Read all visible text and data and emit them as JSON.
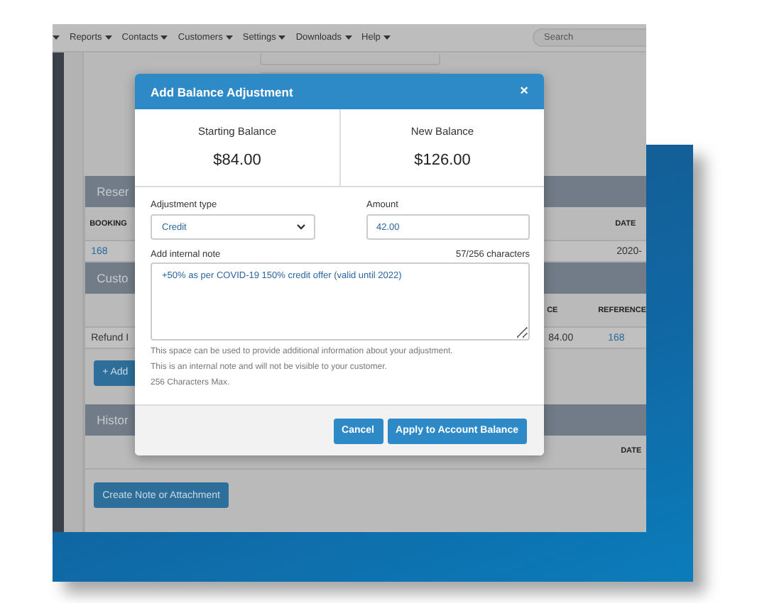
{
  "app": {
    "nav": {
      "leading_caret": true,
      "items": [
        "Reports",
        "Contacts",
        "Customers",
        "Settings",
        "Downloads",
        "Help"
      ],
      "search": {
        "placeholder": "Search"
      }
    },
    "reservations": {
      "title": "Reser",
      "columns": [
        "BOOKING",
        "DATE"
      ],
      "row": [
        "168",
        "2020-"
      ]
    },
    "customer_credit": {
      "title": "Custo",
      "columns": [
        "CE",
        "REFERENCE"
      ],
      "row": [
        "Refund I",
        "84.00",
        "168"
      ],
      "button": "+ Add"
    },
    "history": {
      "title": "Histor",
      "columns": [
        "DATE"
      ],
      "button": "Create Note or Attachment"
    }
  },
  "modal": {
    "title": "Add Balance Adjustment",
    "close": "×",
    "balances": [
      {
        "label": "Starting Balance",
        "value": "$84.00"
      },
      {
        "label": "New Balance",
        "value": "$126.00"
      }
    ],
    "type_field": {
      "label": "Adjustment type",
      "value": "Credit"
    },
    "amount_field": {
      "label": "Amount",
      "value": "42.00"
    },
    "note": {
      "label": "Add internal note",
      "counter": "57/256 characters",
      "value": "+50% as per COVID-19 150% credit offer (valid until 2022)",
      "help": [
        "This space can be used to provide additional information about your adjustment.",
        "This is an internal note and will not be visible to your customer.",
        "256 Characters Max."
      ]
    },
    "buttons": [
      {
        "label": "Cancel"
      },
      {
        "label": "Apply to Account Balance"
      }
    ]
  }
}
